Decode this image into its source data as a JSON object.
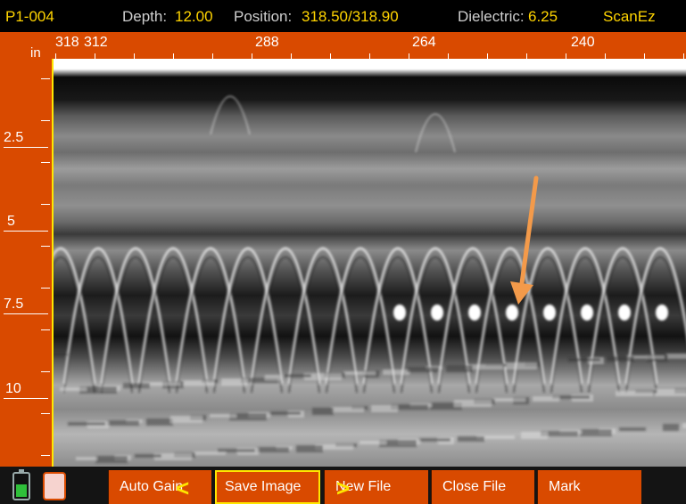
{
  "status": {
    "file_id": "P1-004",
    "depth_label": "Depth:",
    "depth_value": "12.00",
    "position_label": "Position:",
    "position_value": "318.50/318.90",
    "dielectric_label": "Dielectric:",
    "dielectric_value": "6.25",
    "mode": "ScanEz"
  },
  "ruler": {
    "unit": "in",
    "top_labels": [
      "318",
      "312",
      "288",
      "264",
      "240"
    ],
    "left_labels": [
      "2.5",
      "5",
      "7.5",
      "10"
    ]
  },
  "toolbar": {
    "auto_gain": "Auto Gain",
    "save_image": "Save Image",
    "new_file": "New File",
    "close_file": "Close File",
    "mark": "Mark",
    "battery_level": 0.55
  },
  "colors": {
    "accent": "#d94a00",
    "value_text": "#ffd400",
    "selection": "#ffe600",
    "annotation_arrow": "#f39a4a",
    "battery": "#2fbf3a"
  },
  "icons": {
    "battery": "battery-icon",
    "storage": "storage-card-icon",
    "nav_left": "chevron-left-icon",
    "nav_right": "chevron-right-icon",
    "annotation": "arrow-annotation-icon"
  }
}
